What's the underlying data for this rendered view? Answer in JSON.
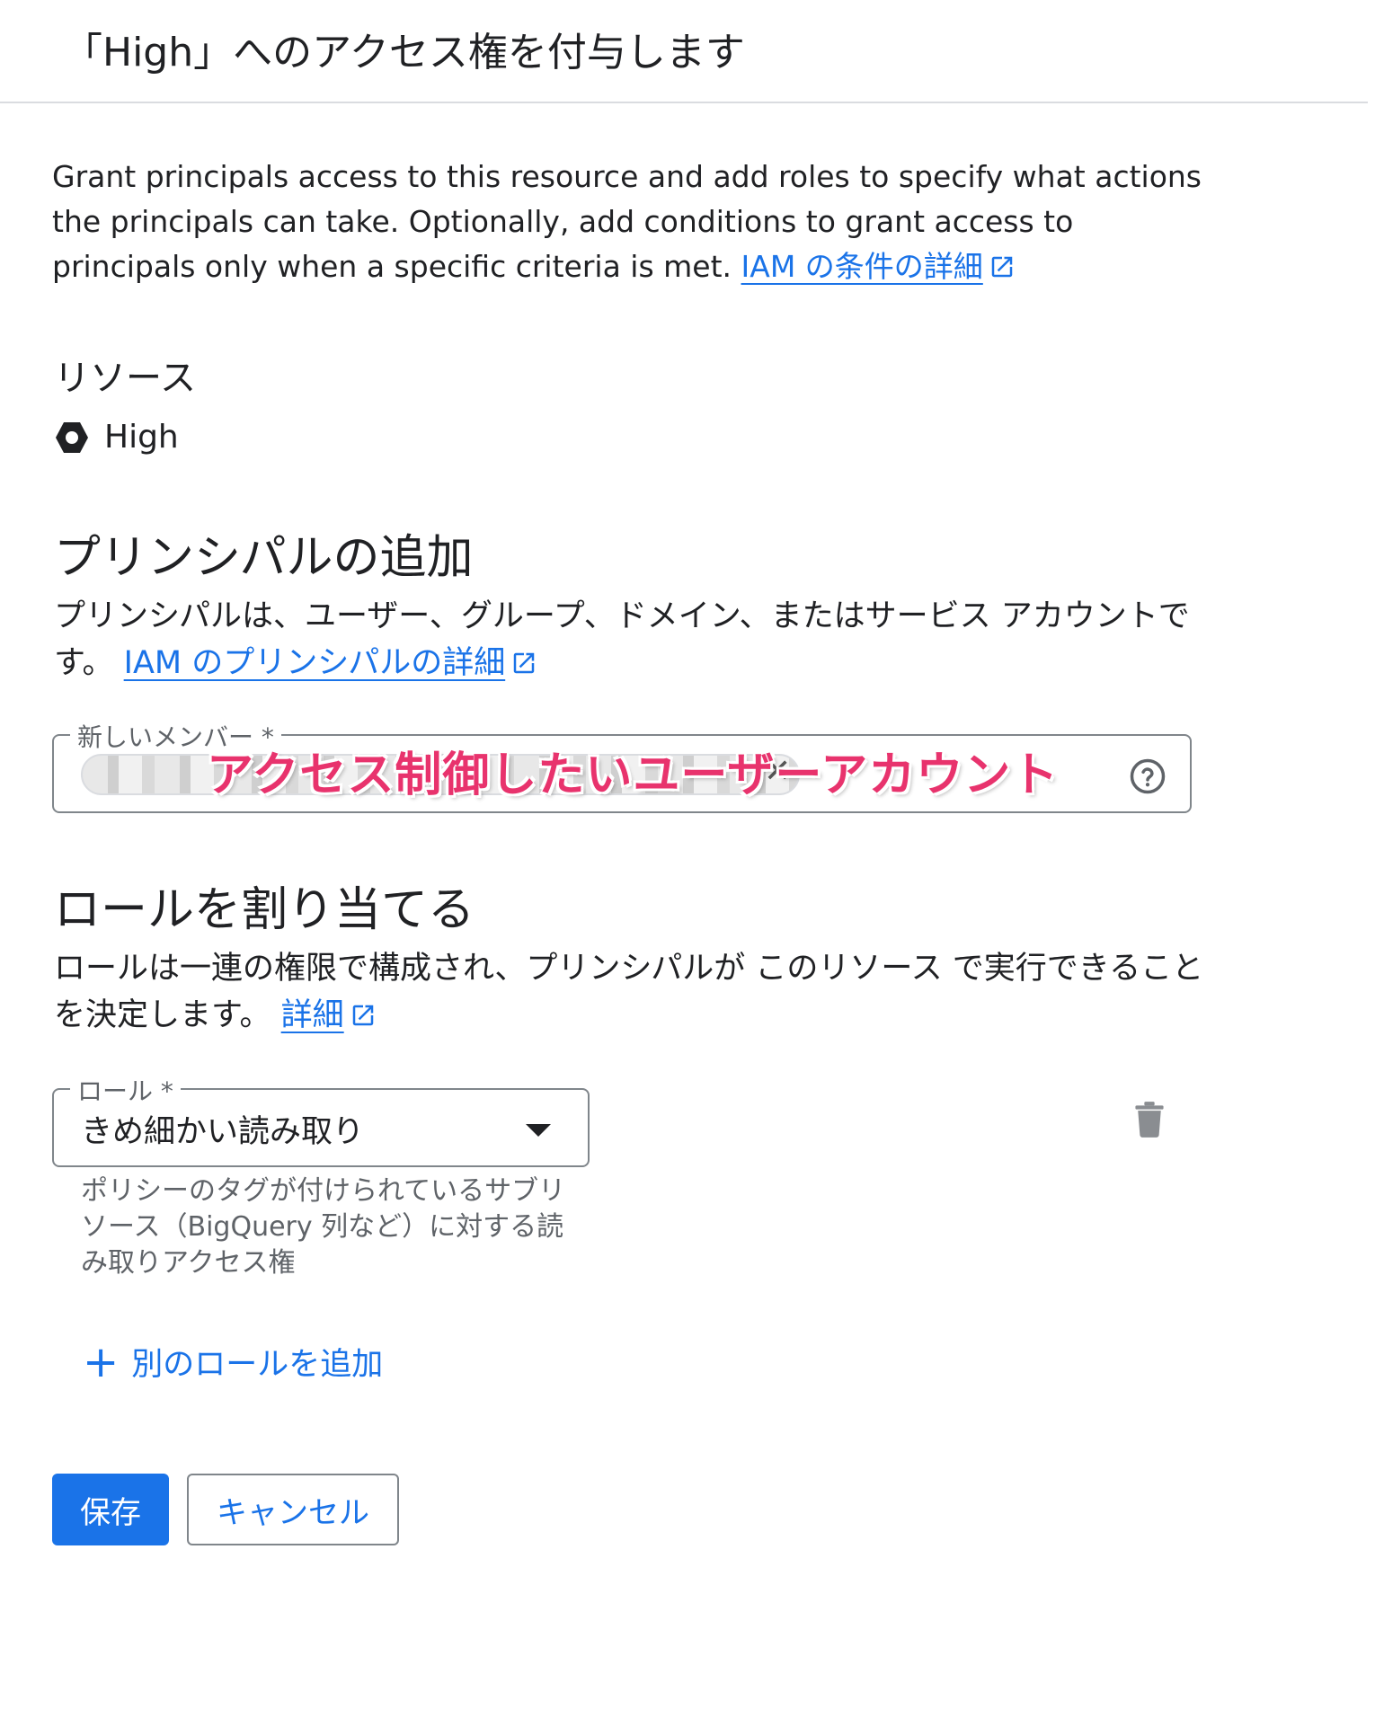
{
  "header": {
    "title": "「High」へのアクセス権を付与します"
  },
  "intro": {
    "text": "Grant principals access to this resource and add roles to specify what actions the principals can take. Optionally, add conditions to grant access to principals only when a specific criteria is met.",
    "link_label": "IAM の条件の詳細"
  },
  "resource": {
    "label": "リソース",
    "name": "High",
    "icon": "project-hexagon-icon"
  },
  "add_principals": {
    "heading": "プリンシパルの追加",
    "description": "プリンシパルは、ユーザー、グループ、ドメイン、またはサービス アカウントです。",
    "link_label": "IAM のプリンシパルの詳細",
    "field_label": "新しいメンバー *",
    "annotation": "アクセス制御したいユーザーアカウント"
  },
  "assign_roles": {
    "heading": "ロールを割り当てる",
    "description": "ロールは一連の権限で構成され、プリンシパルが このリソース で実行できることを決定します。",
    "link_label": "詳細",
    "role_field_label": "ロール *",
    "role_value": "きめ細かい読み取り",
    "role_hint": "ポリシーのタグが付けられているサブリソース（BigQuery 列など）に対する読み取りアクセス権",
    "add_role_label": "別のロールを追加"
  },
  "actions": {
    "save_label": "保存",
    "cancel_label": "キャンセル"
  },
  "colors": {
    "accent": "#1a73e8",
    "annotation": "#e8336d",
    "border": "#80868b"
  }
}
